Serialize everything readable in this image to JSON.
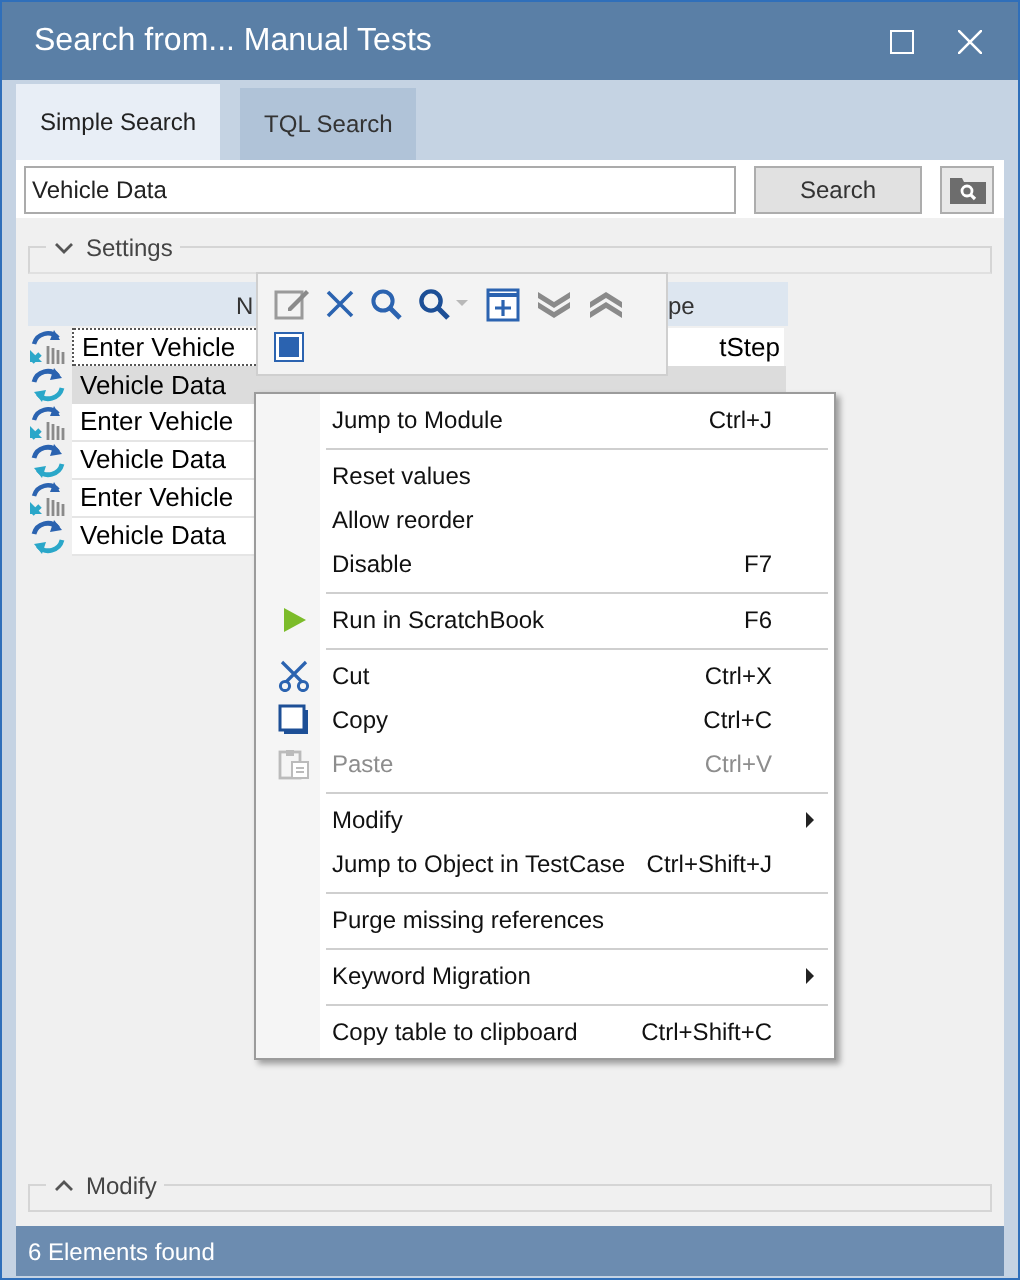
{
  "window": {
    "title": "Search from... Manual Tests"
  },
  "tabs": [
    {
      "label": "Simple Search",
      "selected": true
    },
    {
      "label": "TQL Search",
      "selected": false
    }
  ],
  "search": {
    "value": "Vehicle Data",
    "button": "Search"
  },
  "settings_group": {
    "label": "Settings",
    "expanded": true
  },
  "table": {
    "columns": [
      "N",
      "pe"
    ],
    "rows": [
      {
        "kind": "manual",
        "name": "Enter Vehicle",
        "type": "tStep",
        "selected": false
      },
      {
        "kind": "module",
        "name": "Vehicle Data",
        "selected": true
      },
      {
        "kind": "manual",
        "name": "Enter Vehicle",
        "selected": false
      },
      {
        "kind": "module",
        "name": "Vehicle Data",
        "selected": false
      },
      {
        "kind": "manual",
        "name": "Enter Vehicle",
        "selected": false
      },
      {
        "kind": "module",
        "name": "Vehicle Data",
        "selected": false
      }
    ]
  },
  "context_menu": {
    "items": [
      {
        "kind": "item",
        "label": "Jump to Module",
        "shortcut": "Ctrl+J"
      },
      {
        "kind": "separator"
      },
      {
        "kind": "item",
        "label": "Reset values"
      },
      {
        "kind": "item",
        "label": "Allow reorder"
      },
      {
        "kind": "item",
        "label": "Disable",
        "shortcut": "F7"
      },
      {
        "kind": "separator"
      },
      {
        "kind": "item",
        "label": "Run in ScratchBook",
        "shortcut": "F6"
      },
      {
        "kind": "separator"
      },
      {
        "kind": "item",
        "label": "Cut",
        "shortcut": "Ctrl+X"
      },
      {
        "kind": "item",
        "label": "Copy",
        "shortcut": "Ctrl+C"
      },
      {
        "kind": "item",
        "label": "Paste",
        "shortcut": "Ctrl+V",
        "disabled": true
      },
      {
        "kind": "separator"
      },
      {
        "kind": "item",
        "label": "Modify",
        "submenu": true
      },
      {
        "kind": "item",
        "label": "Jump to Object in TestCase",
        "shortcut": "Ctrl+Shift+J"
      },
      {
        "kind": "separator"
      },
      {
        "kind": "item",
        "label": "Purge missing references"
      },
      {
        "kind": "separator"
      },
      {
        "kind": "item",
        "label": "Keyword Migration",
        "submenu": true
      },
      {
        "kind": "separator"
      },
      {
        "kind": "item",
        "label": "Copy table to clipboard",
        "shortcut": "Ctrl+Shift+C"
      }
    ]
  },
  "modify_group": {
    "label": "Modify",
    "expanded": false
  },
  "status_bar": {
    "text": "6 Elements found"
  }
}
